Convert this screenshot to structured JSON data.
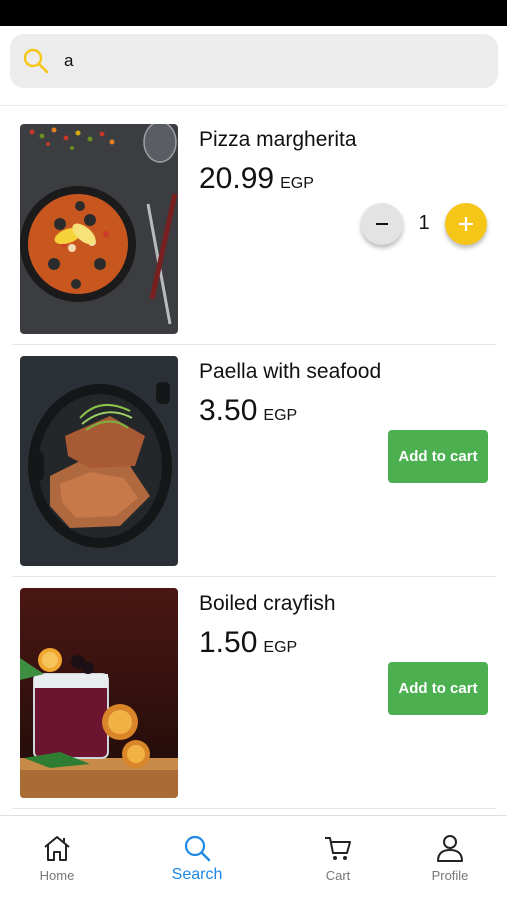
{
  "search": {
    "value": "a",
    "placeholder": "Search"
  },
  "currency": "EGP",
  "items": [
    {
      "name": "Pizza margherita",
      "price": "20.99",
      "quantity": "1"
    },
    {
      "name": "Paella with seafood",
      "price": "3.50",
      "action_label": "Add to cart"
    },
    {
      "name": "Boiled crayfish",
      "price": "1.50",
      "action_label": "Add to cart"
    }
  ],
  "nav": {
    "home": "Home",
    "search": "Search",
    "cart": "Cart",
    "profile": "Profile"
  },
  "colors": {
    "accent_yellow": "#f5c518",
    "add_button_green": "#4caf50",
    "active_nav_blue": "#1e88e5"
  }
}
